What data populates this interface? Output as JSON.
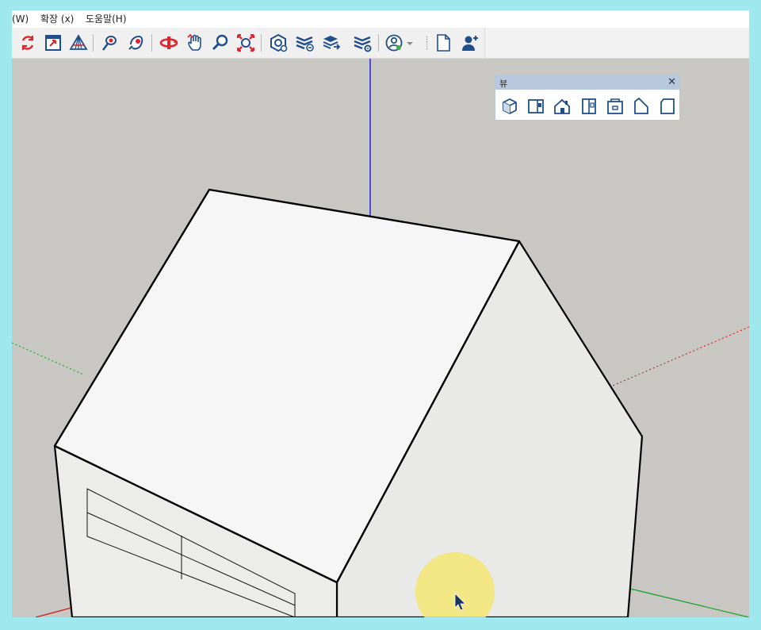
{
  "menu": {
    "items": [
      {
        "label": "(W)"
      },
      {
        "label": "확장 (x)"
      },
      {
        "label": "도움말(H)"
      }
    ]
  },
  "toolbar": {
    "tools": [
      {
        "name": "orbit-refresh-icon"
      },
      {
        "name": "section-plane-icon"
      },
      {
        "name": "perspective-icon"
      },
      {
        "name": "position-camera-icon"
      },
      {
        "name": "look-around-icon"
      },
      {
        "name": "orbit-icon"
      },
      {
        "name": "pan-icon"
      },
      {
        "name": "zoom-icon"
      },
      {
        "name": "zoom-extents-icon"
      },
      {
        "name": "3d-warehouse-icon"
      },
      {
        "name": "layers-share-icon"
      },
      {
        "name": "layers-export-icon"
      },
      {
        "name": "layers-settings-icon"
      },
      {
        "name": "account-icon"
      },
      {
        "name": "new-document-icon"
      },
      {
        "name": "add-user-icon"
      }
    ]
  },
  "views_panel": {
    "title": "뷰",
    "close": "✕",
    "buttons": [
      "iso-view-icon",
      "top-view-icon",
      "front-view-icon",
      "right-view-icon",
      "back-view-icon",
      "left-view-icon",
      "bottom-view-icon"
    ]
  },
  "colors": {
    "viewport_bg": "#c8c7c3",
    "axis_blue": "#1a1ae0",
    "axis_red": "#d01010",
    "axis_green": "#10a020",
    "toolbar_red": "#e0262b",
    "toolbar_blue": "#1f4e8c",
    "cursor_highlight": "#f3e57a"
  }
}
